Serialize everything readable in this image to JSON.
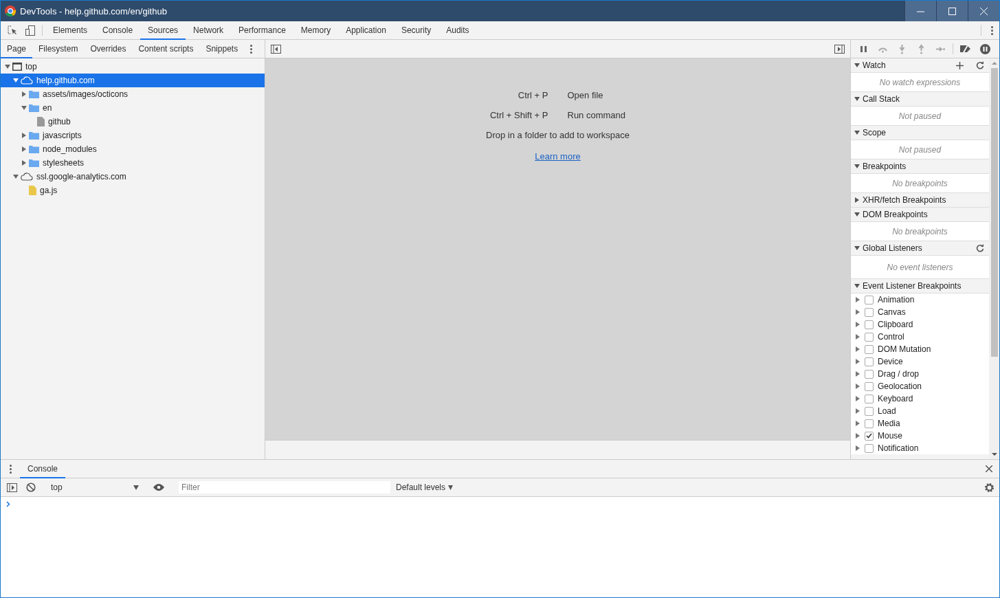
{
  "window": {
    "title": "DevTools - help.github.com/en/github"
  },
  "main_tabs": [
    {
      "label": "Elements",
      "selected": false
    },
    {
      "label": "Console",
      "selected": false
    },
    {
      "label": "Sources",
      "selected": true
    },
    {
      "label": "Network",
      "selected": false
    },
    {
      "label": "Performance",
      "selected": false
    },
    {
      "label": "Memory",
      "selected": false
    },
    {
      "label": "Application",
      "selected": false
    },
    {
      "label": "Security",
      "selected": false
    },
    {
      "label": "Audits",
      "selected": false
    }
  ],
  "navigator_tabs": [
    {
      "label": "Page",
      "selected": true
    },
    {
      "label": "Filesystem",
      "selected": false
    },
    {
      "label": "Overrides",
      "selected": false
    },
    {
      "label": "Content scripts",
      "selected": false
    },
    {
      "label": "Snippets",
      "selected": false
    }
  ],
  "tree": [
    {
      "kind": "frame",
      "label": "top",
      "expanded": true,
      "selected": false,
      "children": [
        {
          "kind": "domain",
          "label": "help.github.com",
          "expanded": true,
          "selected": true,
          "children": [
            {
              "kind": "folder",
              "label": "assets/images/octicons",
              "expanded": false,
              "selected": false
            },
            {
              "kind": "folder",
              "label": "en",
              "expanded": true,
              "selected": false,
              "children": [
                {
                  "kind": "file",
                  "label": "github",
                  "selected": false
                }
              ]
            },
            {
              "kind": "folder",
              "label": "javascripts",
              "expanded": false,
              "selected": false
            },
            {
              "kind": "folder",
              "label": "node_modules",
              "expanded": false,
              "selected": false
            },
            {
              "kind": "folder",
              "label": "stylesheets",
              "expanded": false,
              "selected": false
            }
          ]
        },
        {
          "kind": "domain",
          "label": "ssl.google-analytics.com",
          "expanded": true,
          "selected": false,
          "children": [
            {
              "kind": "script",
              "label": "ga.js",
              "selected": false
            }
          ]
        }
      ]
    }
  ],
  "editor": {
    "shortcuts": [
      {
        "keys": "Ctrl + P",
        "action": "Open file"
      },
      {
        "keys": "Ctrl + Shift + P",
        "action": "Run command"
      }
    ],
    "hint": "Drop in a folder to add to workspace",
    "link": "Learn more"
  },
  "debugger": {
    "sections": [
      {
        "title": "Watch",
        "expanded": true,
        "message": "No watch expressions",
        "buttons": [
          {
            "kind": "add"
          },
          {
            "kind": "refresh"
          }
        ]
      },
      {
        "title": "Call Stack",
        "expanded": true,
        "message": "Not paused"
      },
      {
        "title": "Scope",
        "expanded": true,
        "message": "Not paused"
      },
      {
        "title": "Breakpoints",
        "expanded": true,
        "message": "No breakpoints"
      },
      {
        "title": "XHR/fetch Breakpoints",
        "expanded": false
      },
      {
        "title": "DOM Breakpoints",
        "expanded": true,
        "message": "No breakpoints"
      },
      {
        "title": "Global Listeners",
        "expanded": true,
        "message": "No event listeners",
        "buttons": [
          {
            "kind": "refresh"
          }
        ]
      },
      {
        "title": "Event Listener Breakpoints",
        "expanded": true
      }
    ],
    "event_breakpoints": [
      {
        "label": "Animation",
        "checked": false,
        "expanded": false
      },
      {
        "label": "Canvas",
        "checked": false,
        "expanded": false
      },
      {
        "label": "Clipboard",
        "checked": false,
        "expanded": false
      },
      {
        "label": "Control",
        "checked": false,
        "expanded": false
      },
      {
        "label": "DOM Mutation",
        "checked": false,
        "expanded": false
      },
      {
        "label": "Device",
        "checked": false,
        "expanded": false
      },
      {
        "label": "Drag / drop",
        "checked": false,
        "expanded": false
      },
      {
        "label": "Geolocation",
        "checked": false,
        "expanded": false
      },
      {
        "label": "Keyboard",
        "checked": false,
        "expanded": false
      },
      {
        "label": "Load",
        "checked": false,
        "expanded": false
      },
      {
        "label": "Media",
        "checked": false,
        "expanded": false
      },
      {
        "label": "Mouse",
        "checked": true,
        "expanded": false
      },
      {
        "label": "Notification",
        "checked": false,
        "expanded": false
      }
    ]
  },
  "drawer": {
    "tabs": [
      {
        "label": "Console",
        "selected": true
      }
    ],
    "context": "top",
    "filter": {
      "placeholder": "Filter"
    },
    "levels": "Default levels"
  }
}
